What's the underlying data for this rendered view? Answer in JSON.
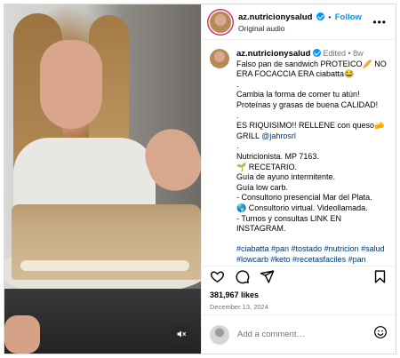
{
  "header": {
    "username": "az.nutricionysalud",
    "separator": "•",
    "follow_label": "Follow",
    "subtitle": "Original audio",
    "more_icon": "more-horizontal-icon"
  },
  "caption": {
    "username": "az.nutricionysalud",
    "edited": "Edited",
    "dot": "•",
    "age": "8w",
    "line1": "Falso pan de sandwich PROTEICO🥖 NO ERA FOCACCIA ERA ciabatta😂",
    "dot1": ".",
    "line2": "Cambia la forma de comer tu atún! Proteínas y grasas de buena CALIDAD!",
    "dot2": ".",
    "line3_text": "ES RIQUISIMO!! RELLENE con queso🧀 GRILL ",
    "line3_mention": "@jahrosrl",
    "dot3": ".",
    "line4": "Nutricionista. MP 7163.",
    "line5": "🌱 RECETARIO.",
    "line6": "Guía de ayuno intermitente.",
    "line7": "Guía low carb.",
    "line8": "- Consultorio presencial Mar del Plata.",
    "line9": "🌎 Consultorio virtual. Videollamada.",
    "line10": "- Turnos y consultas LINK EN INSTAGRAM.",
    "hashtags1": "#ciabatta #pan #tostado #nutricion #salud",
    "hashtags2": "#lowcarb #keto #recetasfaciles #pan"
  },
  "actions": {
    "like_icon": "heart-icon",
    "comment_icon": "comment-icon",
    "share_icon": "send-icon",
    "save_icon": "bookmark-icon"
  },
  "likes": "381,967 likes",
  "date": "December 13, 2024",
  "comment_box": {
    "placeholder": "Add a comment…",
    "emoji_icon": "emoji-icon"
  },
  "media": {
    "mute_icon": "speaker-muted-icon"
  },
  "colors": {
    "accent": "#0095f6",
    "link": "#00376b",
    "muted": "#737373",
    "border": "#dbdbdb"
  }
}
